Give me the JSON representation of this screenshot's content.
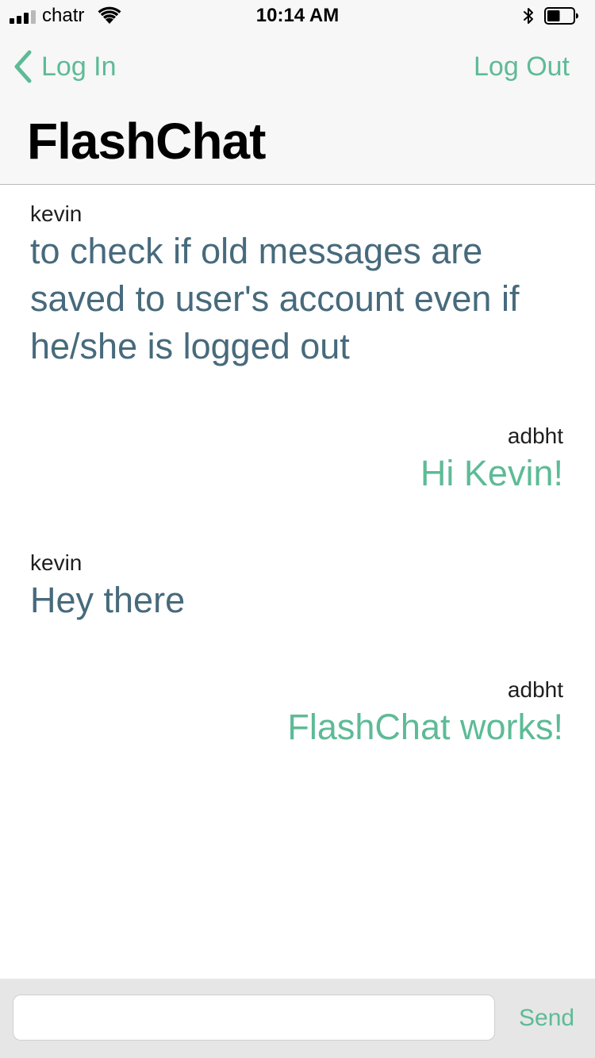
{
  "status_bar": {
    "carrier": "chatr",
    "time": "10:14 AM",
    "signal_bars_filled": 3,
    "signal_bars_total": 4,
    "battery_level": 0.5,
    "icons": [
      "signal-icon",
      "wifi-icon",
      "bluetooth-icon",
      "battery-icon"
    ]
  },
  "nav": {
    "back_label": "Log In",
    "back_icon": "chevron-left-icon",
    "right_label": "Log Out",
    "title": "FlashChat"
  },
  "messages": [
    {
      "sender": "kevin",
      "text": "to check if old messages are saved to user's account even if he/she is logged out",
      "direction": "incoming"
    },
    {
      "sender": "adbht",
      "text": "Hi Kevin!",
      "direction": "outgoing"
    },
    {
      "sender": "kevin",
      "text": "Hey there",
      "direction": "incoming"
    },
    {
      "sender": "adbht",
      "text": "FlashChat works!",
      "direction": "outgoing"
    }
  ],
  "composer": {
    "input_value": "",
    "input_placeholder": "",
    "send_label": "Send"
  },
  "colors": {
    "accent": "#5dbb96",
    "incoming_text": "#476a7c",
    "sender_text": "#1e1e1e",
    "nav_background": "#f7f7f7",
    "composer_background": "#e6e6e6"
  }
}
